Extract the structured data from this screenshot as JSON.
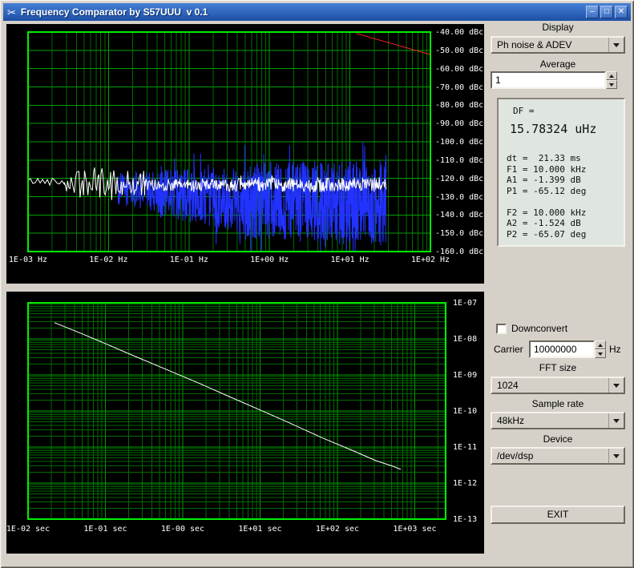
{
  "window": {
    "title": "Frequency Comparator by S57UUU  v 0.1",
    "icon": "✂",
    "buttons": {
      "minimize": "–",
      "maximize": "□",
      "close": "✕"
    }
  },
  "panel": {
    "display_label": "Display",
    "display_value": "Ph noise & ADEV",
    "average_label": "Average",
    "average_value": "1",
    "info": {
      "df_label": "DF =",
      "df_value": "15.78324 uHz",
      "lines": [
        "dt =  21.33 ms",
        "F1 = 10.000 kHz",
        "A1 = -1.399 dB",
        "P1 = -65.12 deg",
        "",
        "F2 = 10.000 kHz",
        "A2 = -1.524 dB",
        "P2 = -65.07 deg"
      ]
    },
    "downconvert_label": "Downconvert",
    "carrier_label": "Carrier",
    "carrier_value": "10000000",
    "carrier_unit": "Hz",
    "fft_label": "FFT size",
    "fft_value": "1024",
    "rate_label": "Sample rate",
    "rate_value": "48kHz",
    "device_label": "Device",
    "device_value": "/dev/dsp",
    "exit_label": "EXIT"
  },
  "colors": {
    "window_bg": "#d5d1c9",
    "titlebar_start": "#477fd6",
    "titlebar_end": "#1c4fa4",
    "plot_bg": "#000000",
    "plot_border": "#00ee00",
    "grid_major": "#00a000",
    "grid_minor": "#006a00",
    "tick_text": "#ffffff",
    "trace_white": "#ffffff",
    "trace_blue": "#2233ff",
    "trace_red": "#ff2222"
  },
  "chart_data": [
    {
      "type": "line",
      "name": "phase-noise-plot",
      "x_ticks": [
        "1E-03 Hz",
        "1E-02 Hz",
        "1E-01 Hz",
        "1E+00 Hz",
        "1E+01 Hz",
        "1E+02 Hz"
      ],
      "y_ticks": [
        "-40.00 dBc",
        "-50.00 dBc",
        "-60.00 dBc",
        "-70.00 dBc",
        "-80.00 dBc",
        "-90.00 dBc",
        "-100.0 dBc",
        "-110.0 dBc",
        "-120.0 dBc",
        "-130.0 dBc",
        "-140.0 dBc",
        "-150.0 dBc",
        "-160.0 dBc"
      ],
      "xlog_range": [
        -3,
        2
      ],
      "y_range": [
        -40,
        -160
      ],
      "grid": true,
      "legend": "none",
      "series": [
        {
          "name": "blue-noise-trace",
          "color": "#2233ff",
          "kind": "noise",
          "seed": 1234,
          "spike_prob": 0.07,
          "spike_gain": 1.6,
          "segments": [
            [
              -1.88,
              -1.4,
              -126,
              -127,
              9,
              11,
              90
            ],
            [
              -1.4,
              -0.3,
              -128,
              -131,
              13,
              19,
              280
            ],
            [
              -0.3,
              1.45,
              -132,
              -134,
              21,
              24,
              650
            ]
          ]
        },
        {
          "name": "white-phase-trace",
          "color": "#ffffff",
          "kind": "noise",
          "seed": 42,
          "spike_prob": 0.04,
          "spike_gain": 1.4,
          "segments": [
            [
              -3.0,
              -2.55,
              -121.5,
              -121.5,
              1.8,
              2.5,
              16
            ],
            [
              -2.55,
              -2.2,
              -122,
              -123,
              5,
              9,
              26
            ],
            [
              -2.2,
              -1.55,
              -123,
              -123,
              9,
              9,
              50
            ],
            [
              -1.55,
              1.45,
              -123.5,
              -123.5,
              3.2,
              4.2,
              420
            ]
          ]
        },
        {
          "name": "red-reference-line",
          "color": "#ff2222",
          "kind": "polyline",
          "points": [
            [
              1.08,
              -40.8
            ],
            [
              2.0,
              -52.3
            ]
          ]
        }
      ]
    },
    {
      "type": "line",
      "name": "adev-plot",
      "x_ticks": [
        "1E-02 sec",
        "1E-01 sec",
        "1E-00 sec",
        "1E+01 sec",
        "1E+02 sec",
        "1E+03 sec"
      ],
      "y_ticks": [
        "1E-07",
        "1E-08",
        "1E-09",
        "1E-10",
        "1E-11",
        "1E-12",
        "1E-13"
      ],
      "xlog_range": [
        -2,
        3.4
      ],
      "ylog_range": [
        -7,
        -13
      ],
      "grid": true,
      "legend": "none",
      "series": [
        {
          "name": "adev-trace",
          "color": "#ffffff",
          "kind": "polyline",
          "points": [
            [
              -1.66,
              -7.55
            ],
            [
              -1.3,
              -7.86
            ],
            [
              -1.0,
              -8.13
            ],
            [
              -0.6,
              -8.5
            ],
            [
              -0.2,
              -8.86
            ],
            [
              0.2,
              -9.22
            ],
            [
              0.6,
              -9.6
            ],
            [
              1.0,
              -9.97
            ],
            [
              1.4,
              -10.35
            ],
            [
              1.8,
              -10.74
            ],
            [
              2.2,
              -11.1
            ],
            [
              2.5,
              -11.38
            ],
            [
              2.7,
              -11.52
            ],
            [
              2.82,
              -11.62
            ]
          ]
        }
      ]
    }
  ]
}
